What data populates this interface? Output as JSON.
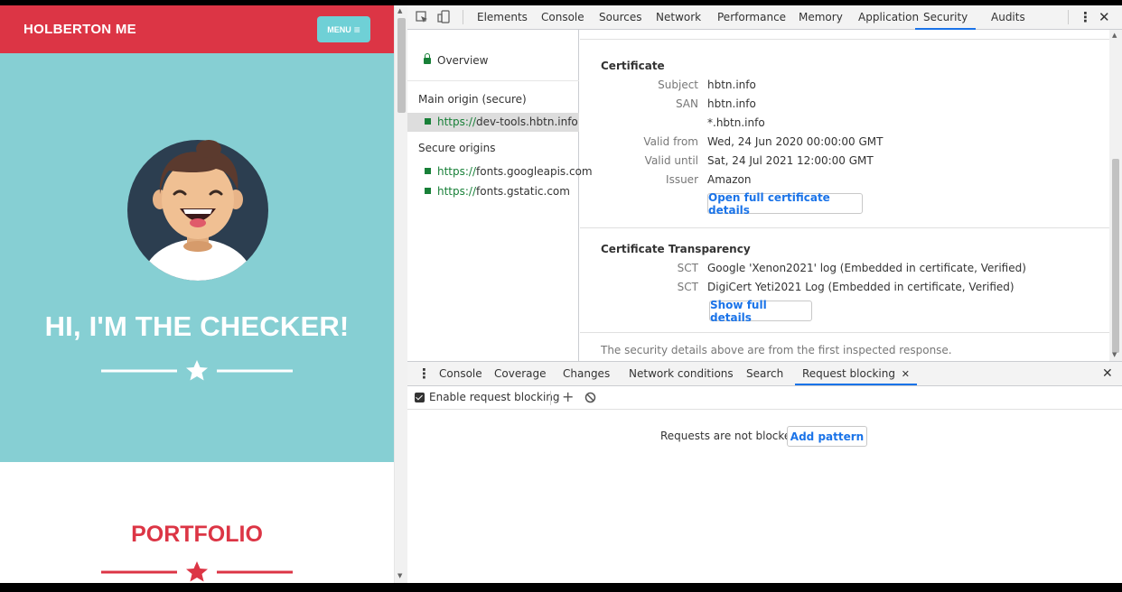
{
  "site": {
    "brand": "HOLBERTON ME",
    "menu_label": "MENU",
    "menu_icon": "hamburger-icon",
    "hero_title": "HI, I'M THE CHECKER!",
    "portfolio_title": "PORTFOLIO",
    "colors": {
      "nav": "#dc3545",
      "hero": "#86cfd3",
      "menu_button": "#6fd0d6"
    }
  },
  "devtools": {
    "tabs": [
      {
        "label": "Elements"
      },
      {
        "label": "Console"
      },
      {
        "label": "Sources"
      },
      {
        "label": "Network"
      },
      {
        "label": "Performance"
      },
      {
        "label": "Memory"
      },
      {
        "label": "Application"
      },
      {
        "label": "Security",
        "active": true
      },
      {
        "label": "Audits"
      }
    ],
    "sidebar": {
      "overview": "Overview",
      "main_origin_heading": "Main origin (secure)",
      "main_origin": {
        "scheme": "https://",
        "host": "dev-tools.hbtn.info"
      },
      "secure_origins_heading": "Secure origins",
      "secure_origins": [
        {
          "scheme": "https://",
          "host": "fonts.googleapis.com"
        },
        {
          "scheme": "https://",
          "host": "fonts.gstatic.com"
        }
      ]
    },
    "certificate": {
      "title": "Certificate",
      "rows": [
        {
          "label": "Subject",
          "value": "hbtn.info"
        },
        {
          "label": "SAN",
          "value": "hbtn.info"
        },
        {
          "label": "",
          "value": "*.hbtn.info"
        },
        {
          "label": "Valid from",
          "value": "Wed, 24 Jun 2020 00:00:00 GMT"
        },
        {
          "label": "Valid until",
          "value": "Sat, 24 Jul 2021 12:00:00 GMT"
        },
        {
          "label": "Issuer",
          "value": "Amazon"
        }
      ],
      "button": "Open full certificate details"
    },
    "transparency": {
      "title": "Certificate Transparency",
      "rows": [
        {
          "label": "SCT",
          "value": "Google 'Xenon2021' log (Embedded in certificate, Verified)"
        },
        {
          "label": "SCT",
          "value": "DigiCert Yeti2021 Log (Embedded in certificate, Verified)"
        }
      ],
      "button": "Show full details"
    },
    "note": "The security details above are from the first inspected response.",
    "drawer": {
      "tabs": [
        {
          "label": "Console"
        },
        {
          "label": "Coverage"
        },
        {
          "label": "Changes"
        },
        {
          "label": "Network conditions"
        },
        {
          "label": "Search"
        },
        {
          "label": "Request blocking",
          "active": true
        }
      ],
      "enable_label": "Enable request blocking",
      "enabled": true,
      "empty_text": "Requests are not blocked.",
      "add_pattern": "Add pattern"
    }
  }
}
